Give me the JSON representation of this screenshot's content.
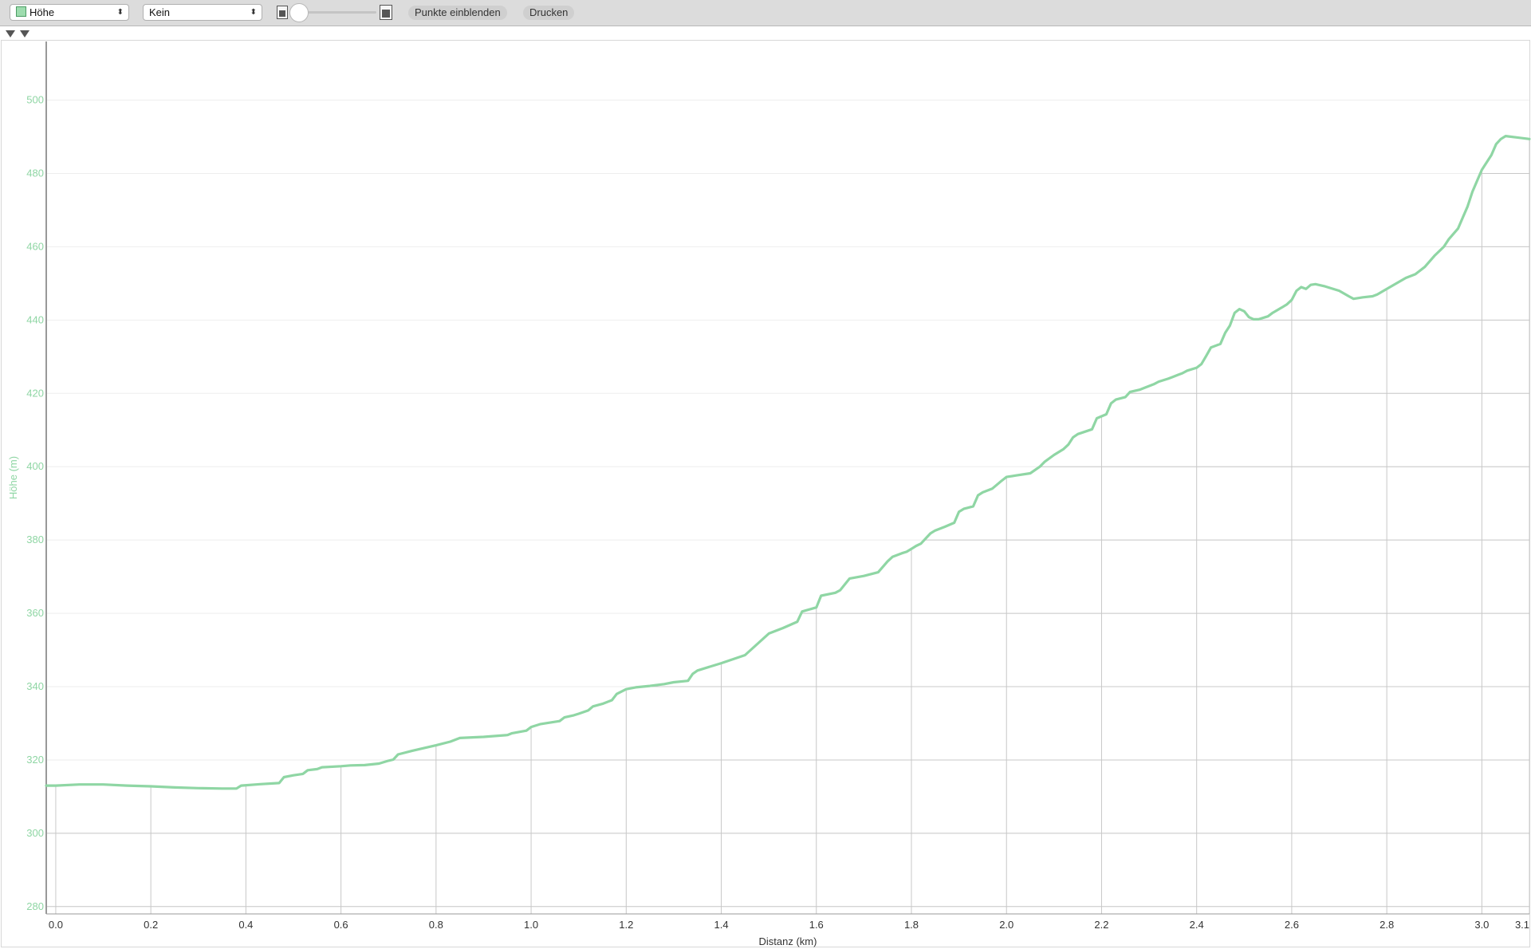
{
  "toolbar": {
    "series_select": {
      "value": "Höhe",
      "swatch_color": "#9ddcae"
    },
    "overlay_select": {
      "value": "Kein"
    },
    "show_points_label": "Punkte einblenden",
    "print_label": "Drucken"
  },
  "colors": {
    "series": "#8fd6a4",
    "grid": "#c8c8c8",
    "grid_faint": "#eeeeee",
    "axis": "#999999"
  },
  "chart_data": {
    "type": "line",
    "xlabel": "Distanz (km)",
    "ylabel": "Höhe (m)",
    "xlim": [
      -0.02,
      3.1
    ],
    "ylim": [
      278,
      516
    ],
    "x_ticks": [
      "0.0",
      "0.2",
      "0.4",
      "0.6",
      "0.8",
      "1.0",
      "1.2",
      "1.4",
      "1.6",
      "1.8",
      "2.0",
      "2.2",
      "2.4",
      "2.6",
      "2.8",
      "3.0",
      "3.1"
    ],
    "y_ticks": [
      280,
      300,
      320,
      340,
      360,
      380,
      400,
      420,
      440,
      460,
      480,
      500
    ],
    "grid": true,
    "series": [
      {
        "color": "#8fd6a4",
        "x": [
          -0.02,
          0.0,
          0.05,
          0.1,
          0.15,
          0.2,
          0.25,
          0.3,
          0.35,
          0.38,
          0.39,
          0.43,
          0.47,
          0.48,
          0.5,
          0.52,
          0.53,
          0.55,
          0.56,
          0.6,
          0.62,
          0.65,
          0.68,
          0.7,
          0.71,
          0.72,
          0.75,
          0.8,
          0.83,
          0.85,
          0.9,
          0.95,
          0.96,
          0.99,
          1.0,
          1.02,
          1.06,
          1.07,
          1.09,
          1.1,
          1.12,
          1.13,
          1.15,
          1.17,
          1.18,
          1.2,
          1.22,
          1.25,
          1.28,
          1.3,
          1.33,
          1.34,
          1.35,
          1.4,
          1.45,
          1.5,
          1.53,
          1.56,
          1.57,
          1.6,
          1.61,
          1.64,
          1.65,
          1.67,
          1.7,
          1.73,
          1.75,
          1.76,
          1.78,
          1.79,
          1.81,
          1.82,
          1.84,
          1.85,
          1.87,
          1.89,
          1.9,
          1.91,
          1.93,
          1.94,
          1.95,
          1.97,
          1.99,
          2.0,
          2.02,
          2.05,
          2.07,
          2.08,
          2.1,
          2.12,
          2.13,
          2.14,
          2.15,
          2.18,
          2.19,
          2.21,
          2.22,
          2.23,
          2.25,
          2.26,
          2.28,
          2.29,
          2.31,
          2.32,
          2.34,
          2.35,
          2.36,
          2.37,
          2.38,
          2.4,
          2.41,
          2.42,
          2.43,
          2.45,
          2.46,
          2.47,
          2.48,
          2.49,
          2.5,
          2.51,
          2.52,
          2.53,
          2.55,
          2.56,
          2.58,
          2.59,
          2.6,
          2.61,
          2.62,
          2.63,
          2.64,
          2.65,
          2.67,
          2.7,
          2.72,
          2.73,
          2.75,
          2.77,
          2.78,
          2.8,
          2.82,
          2.84,
          2.86,
          2.88,
          2.9,
          2.92,
          2.93,
          2.95,
          2.96,
          2.97,
          2.98,
          2.99,
          3.0,
          3.02,
          3.03,
          3.04,
          3.05,
          3.1
        ],
        "y": [
          313,
          313,
          313.3,
          313.3,
          313,
          312.8,
          312.5,
          312.3,
          312.2,
          312.2,
          313,
          313.4,
          313.7,
          315.3,
          315.8,
          316.2,
          317.2,
          317.5,
          318,
          318.3,
          318.5,
          318.6,
          319,
          319.8,
          320.1,
          321.5,
          322.5,
          324,
          325,
          326,
          326.3,
          326.8,
          327.3,
          328,
          329,
          329.8,
          330.6,
          331.6,
          332.2,
          332.6,
          333.5,
          334.6,
          335.3,
          336.3,
          338,
          339.3,
          339.8,
          340.2,
          340.7,
          341.2,
          341.6,
          343.5,
          344.4,
          346.4,
          348.6,
          354.5,
          356,
          357.7,
          360.5,
          361.6,
          364.8,
          365.6,
          366.3,
          369.5,
          370.2,
          371.2,
          374.2,
          375.4,
          376.4,
          376.8,
          378.4,
          379,
          381.8,
          382.6,
          383.6,
          384.7,
          387.7,
          388.5,
          389.2,
          392.2,
          393,
          394,
          396.2,
          397.2,
          397.6,
          398.2,
          400,
          401.3,
          403.2,
          404.8,
          406,
          408,
          408.9,
          410.2,
          413.2,
          414.3,
          417.3,
          418.3,
          419,
          420.4,
          421,
          421.5,
          422.5,
          423.2,
          424,
          424.5,
          425,
          425.5,
          426.2,
          427,
          428,
          430.2,
          432.5,
          433.5,
          436.5,
          438.5,
          442,
          443,
          442.4,
          440.8,
          440.2,
          440.2,
          441,
          442,
          443.5,
          444.3,
          445.5,
          448,
          449,
          448.5,
          449.6,
          449.8,
          449.2,
          448,
          446.5,
          445.8,
          446.2,
          446.5,
          447,
          448.5,
          450,
          451.5,
          452.5,
          454.5,
          457.5,
          460,
          462,
          465,
          468,
          471,
          475,
          478,
          481,
          485,
          488,
          489.4,
          490.2,
          489.4
        ]
      }
    ]
  }
}
